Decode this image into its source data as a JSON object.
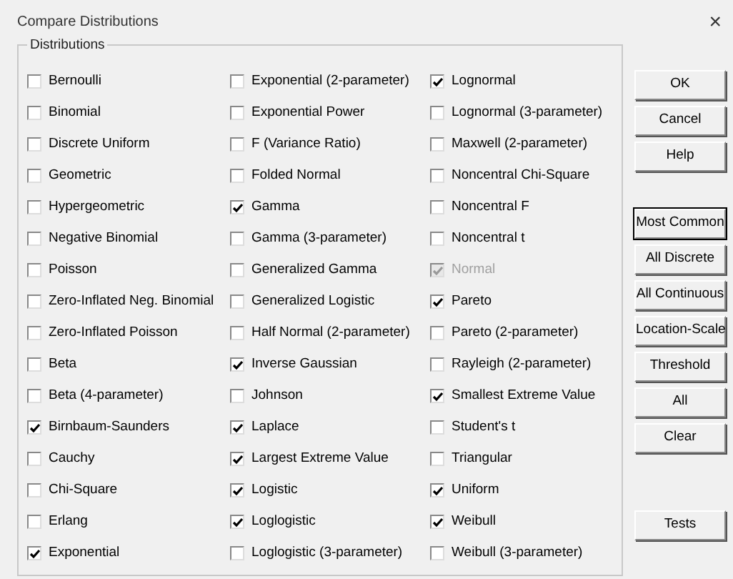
{
  "window": {
    "title": "Compare Distributions",
    "close": "×"
  },
  "group": {
    "label": "Distributions",
    "columns": [
      [
        {
          "label": "Bernoulli",
          "checked": false,
          "disabled": false
        },
        {
          "label": "Binomial",
          "checked": false,
          "disabled": false
        },
        {
          "label": "Discrete Uniform",
          "checked": false,
          "disabled": false
        },
        {
          "label": "Geometric",
          "checked": false,
          "disabled": false
        },
        {
          "label": "Hypergeometric",
          "checked": false,
          "disabled": false
        },
        {
          "label": "Negative Binomial",
          "checked": false,
          "disabled": false
        },
        {
          "label": "Poisson",
          "checked": false,
          "disabled": false
        },
        {
          "label": "Zero-Inflated Neg. Binomial",
          "checked": false,
          "disabled": false
        },
        {
          "label": "Zero-Inflated Poisson",
          "checked": false,
          "disabled": false
        },
        {
          "label": "Beta",
          "checked": false,
          "disabled": false
        },
        {
          "label": "Beta (4-parameter)",
          "checked": false,
          "disabled": false
        },
        {
          "label": "Birnbaum-Saunders",
          "checked": true,
          "disabled": false
        },
        {
          "label": "Cauchy",
          "checked": false,
          "disabled": false
        },
        {
          "label": "Chi-Square",
          "checked": false,
          "disabled": false
        },
        {
          "label": "Erlang",
          "checked": false,
          "disabled": false
        },
        {
          "label": "Exponential",
          "checked": true,
          "disabled": false
        }
      ],
      [
        {
          "label": "Exponential (2-parameter)",
          "checked": false,
          "disabled": false
        },
        {
          "label": "Exponential Power",
          "checked": false,
          "disabled": false
        },
        {
          "label": "F (Variance Ratio)",
          "checked": false,
          "disabled": false
        },
        {
          "label": "Folded Normal",
          "checked": false,
          "disabled": false
        },
        {
          "label": "Gamma",
          "checked": true,
          "disabled": false
        },
        {
          "label": "Gamma (3-parameter)",
          "checked": false,
          "disabled": false
        },
        {
          "label": "Generalized Gamma",
          "checked": false,
          "disabled": false
        },
        {
          "label": "Generalized Logistic",
          "checked": false,
          "disabled": false
        },
        {
          "label": "Half Normal (2-parameter)",
          "checked": false,
          "disabled": false
        },
        {
          "label": "Inverse Gaussian",
          "checked": true,
          "disabled": false
        },
        {
          "label": "Johnson",
          "checked": false,
          "disabled": false
        },
        {
          "label": "Laplace",
          "checked": true,
          "disabled": false
        },
        {
          "label": "Largest Extreme Value",
          "checked": true,
          "disabled": false
        },
        {
          "label": "Logistic",
          "checked": true,
          "disabled": false
        },
        {
          "label": "Loglogistic",
          "checked": true,
          "disabled": false
        },
        {
          "label": "Loglogistic (3-parameter)",
          "checked": false,
          "disabled": false
        }
      ],
      [
        {
          "label": "Lognormal",
          "checked": true,
          "disabled": false
        },
        {
          "label": "Lognormal (3-parameter)",
          "checked": false,
          "disabled": false
        },
        {
          "label": "Maxwell (2-parameter)",
          "checked": false,
          "disabled": false
        },
        {
          "label": "Noncentral Chi-Square",
          "checked": false,
          "disabled": false
        },
        {
          "label": "Noncentral F",
          "checked": false,
          "disabled": false
        },
        {
          "label": "Noncentral t",
          "checked": false,
          "disabled": false
        },
        {
          "label": "Normal",
          "checked": true,
          "disabled": true
        },
        {
          "label": "Pareto",
          "checked": true,
          "disabled": false
        },
        {
          "label": "Pareto (2-parameter)",
          "checked": false,
          "disabled": false
        },
        {
          "label": "Rayleigh (2-parameter)",
          "checked": false,
          "disabled": false
        },
        {
          "label": "Smallest Extreme Value",
          "checked": true,
          "disabled": false
        },
        {
          "label": "Student's t",
          "checked": false,
          "disabled": false
        },
        {
          "label": "Triangular",
          "checked": false,
          "disabled": false
        },
        {
          "label": "Uniform",
          "checked": true,
          "disabled": false
        },
        {
          "label": "Weibull",
          "checked": true,
          "disabled": false
        },
        {
          "label": "Weibull (3-parameter)",
          "checked": false,
          "disabled": false
        }
      ]
    ]
  },
  "button_groups": [
    [
      {
        "label": "OK",
        "focused": false
      },
      {
        "label": "Cancel",
        "focused": false
      },
      {
        "label": "Help",
        "focused": false
      }
    ],
    [
      {
        "label": "Most Common",
        "focused": true
      },
      {
        "label": "All Discrete",
        "focused": false
      },
      {
        "label": "All Continuous",
        "focused": false
      },
      {
        "label": "Location-Scale",
        "focused": false
      },
      {
        "label": "Threshold",
        "focused": false
      },
      {
        "label": "All",
        "focused": false
      },
      {
        "label": "Clear",
        "focused": false
      }
    ],
    [
      {
        "label": "Tests",
        "focused": false
      }
    ]
  ]
}
